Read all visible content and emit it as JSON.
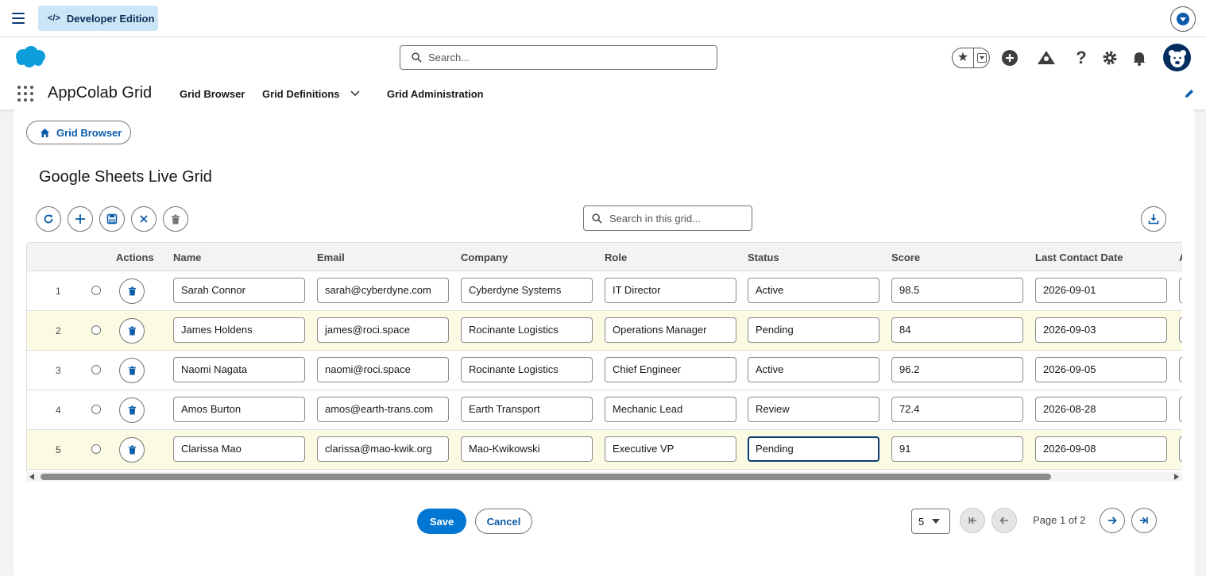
{
  "topbar": {
    "edition_label": "Developer Edition",
    "edition_icon": "code-icon"
  },
  "header": {
    "search_placeholder": "Search..."
  },
  "app": {
    "name": "AppColab Grid",
    "nav": [
      {
        "label": "Grid Browser"
      },
      {
        "label": "Grid Definitions"
      },
      {
        "label": "Grid Administration"
      }
    ]
  },
  "breadcrumb": {
    "label": "Grid Browser"
  },
  "page": {
    "title": "Google Sheets Live Grid"
  },
  "grid": {
    "search_placeholder": "Search in this grid...",
    "columns": [
      "Actions",
      "Name",
      "Email",
      "Company",
      "Role",
      "Status",
      "Score",
      "Last Contact Date",
      "A"
    ],
    "rows": [
      {
        "num": "1",
        "name": "Sarah Connor",
        "email": "sarah@cyberdyne.com",
        "company": "Cyberdyne Systems",
        "role": "IT Director",
        "status": "Active",
        "score": "98.5",
        "date": "2026-09-01"
      },
      {
        "num": "2",
        "name": "James Holdens",
        "email": "james@roci.space",
        "company": "Rocinante Logistics",
        "role": "Operations Manager",
        "status": "Pending",
        "score": "84",
        "date": "2026-09-03"
      },
      {
        "num": "3",
        "name": "Naomi Nagata",
        "email": "naomi@roci.space",
        "company": "Rocinante Logistics",
        "role": "Chief Engineer",
        "status": "Active",
        "score": "96.2",
        "date": "2026-09-05"
      },
      {
        "num": "4",
        "name": "Amos Burton",
        "email": "amos@earth-trans.com",
        "company": "Earth Transport",
        "role": "Mechanic Lead",
        "status": "Review",
        "score": "72.4",
        "date": "2026-08-28"
      },
      {
        "num": "5",
        "name": "Clarissa Mao",
        "email": "clarissa@mao-kwik.org",
        "company": "Mao-Kwikowski",
        "role": "Executive VP",
        "status": "Pending",
        "score": "91",
        "date": "2026-09-08"
      }
    ]
  },
  "footer": {
    "save_label": "Save",
    "cancel_label": "Cancel",
    "page_size": "5",
    "page_info": "Page 1 of 2"
  },
  "colors": {
    "brand_blue": "#0176d3",
    "highlight_row": "#fbfbe4"
  }
}
